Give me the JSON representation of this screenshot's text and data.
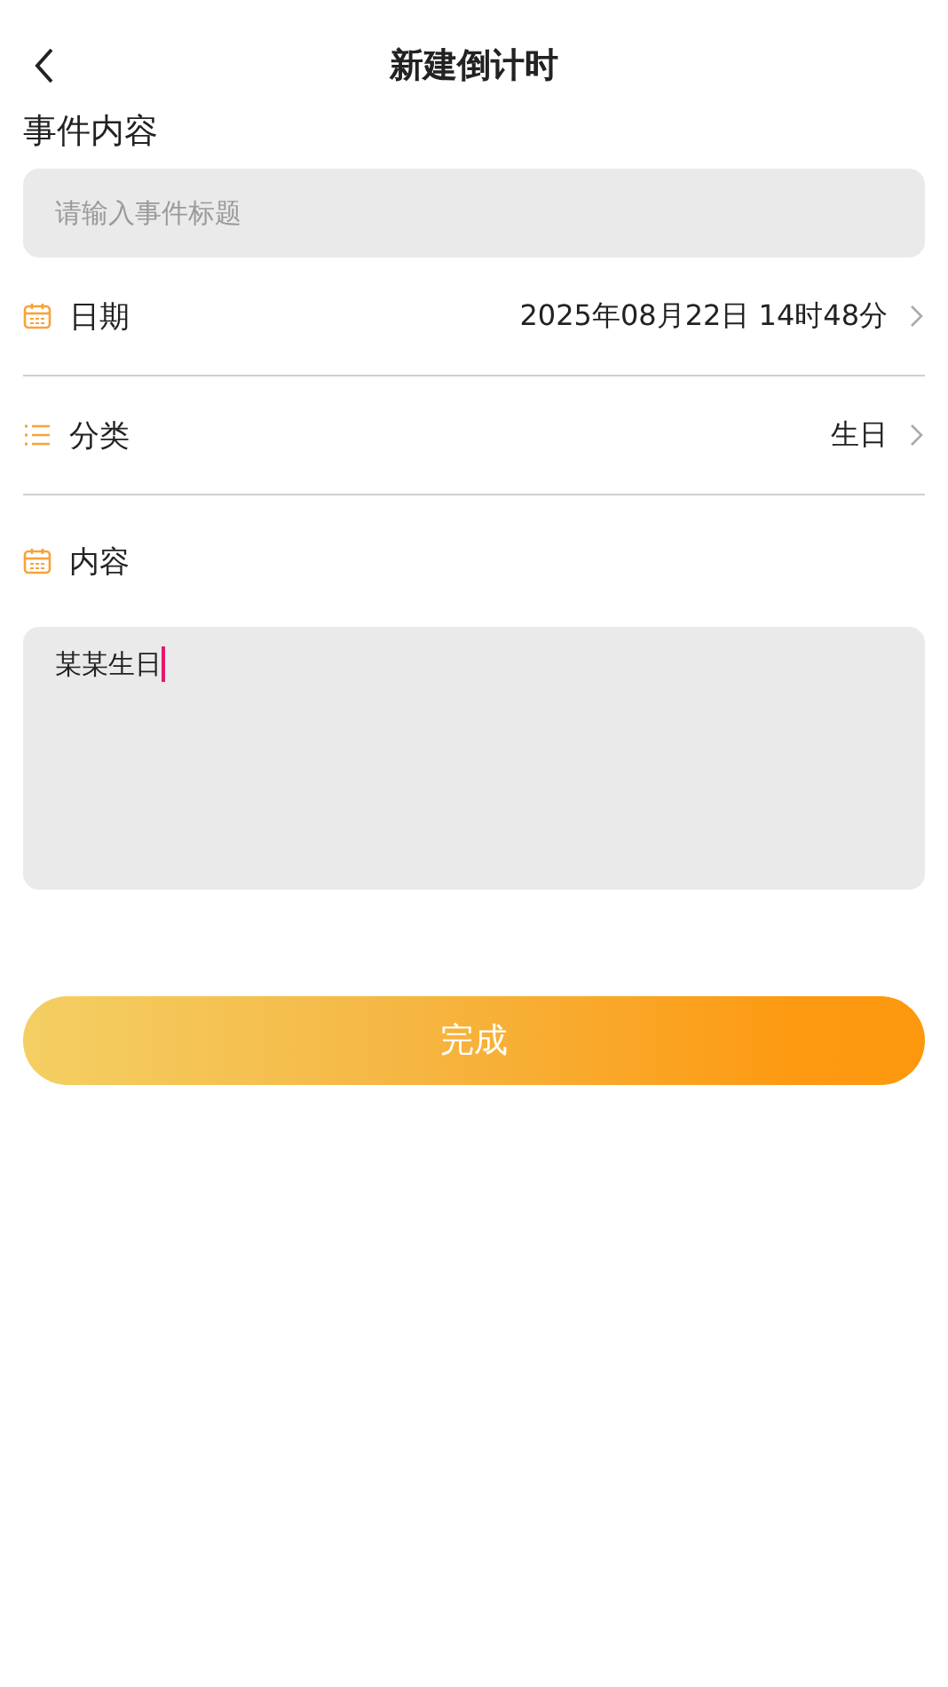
{
  "header": {
    "title": "新建倒计时"
  },
  "title_section": {
    "label": "事件内容",
    "placeholder": "请输入事件标题"
  },
  "rows": [
    {
      "kind": "picker",
      "label": "日期",
      "value": "2025年08月22日 14时48分"
    },
    {
      "kind": "picker",
      "label": "分类",
      "value": "生日"
    },
    {
      "kind": "heading",
      "label": "内容"
    }
  ],
  "content": {
    "value": "某某生日",
    "focused": true
  },
  "submit": {
    "label": "完成"
  }
}
